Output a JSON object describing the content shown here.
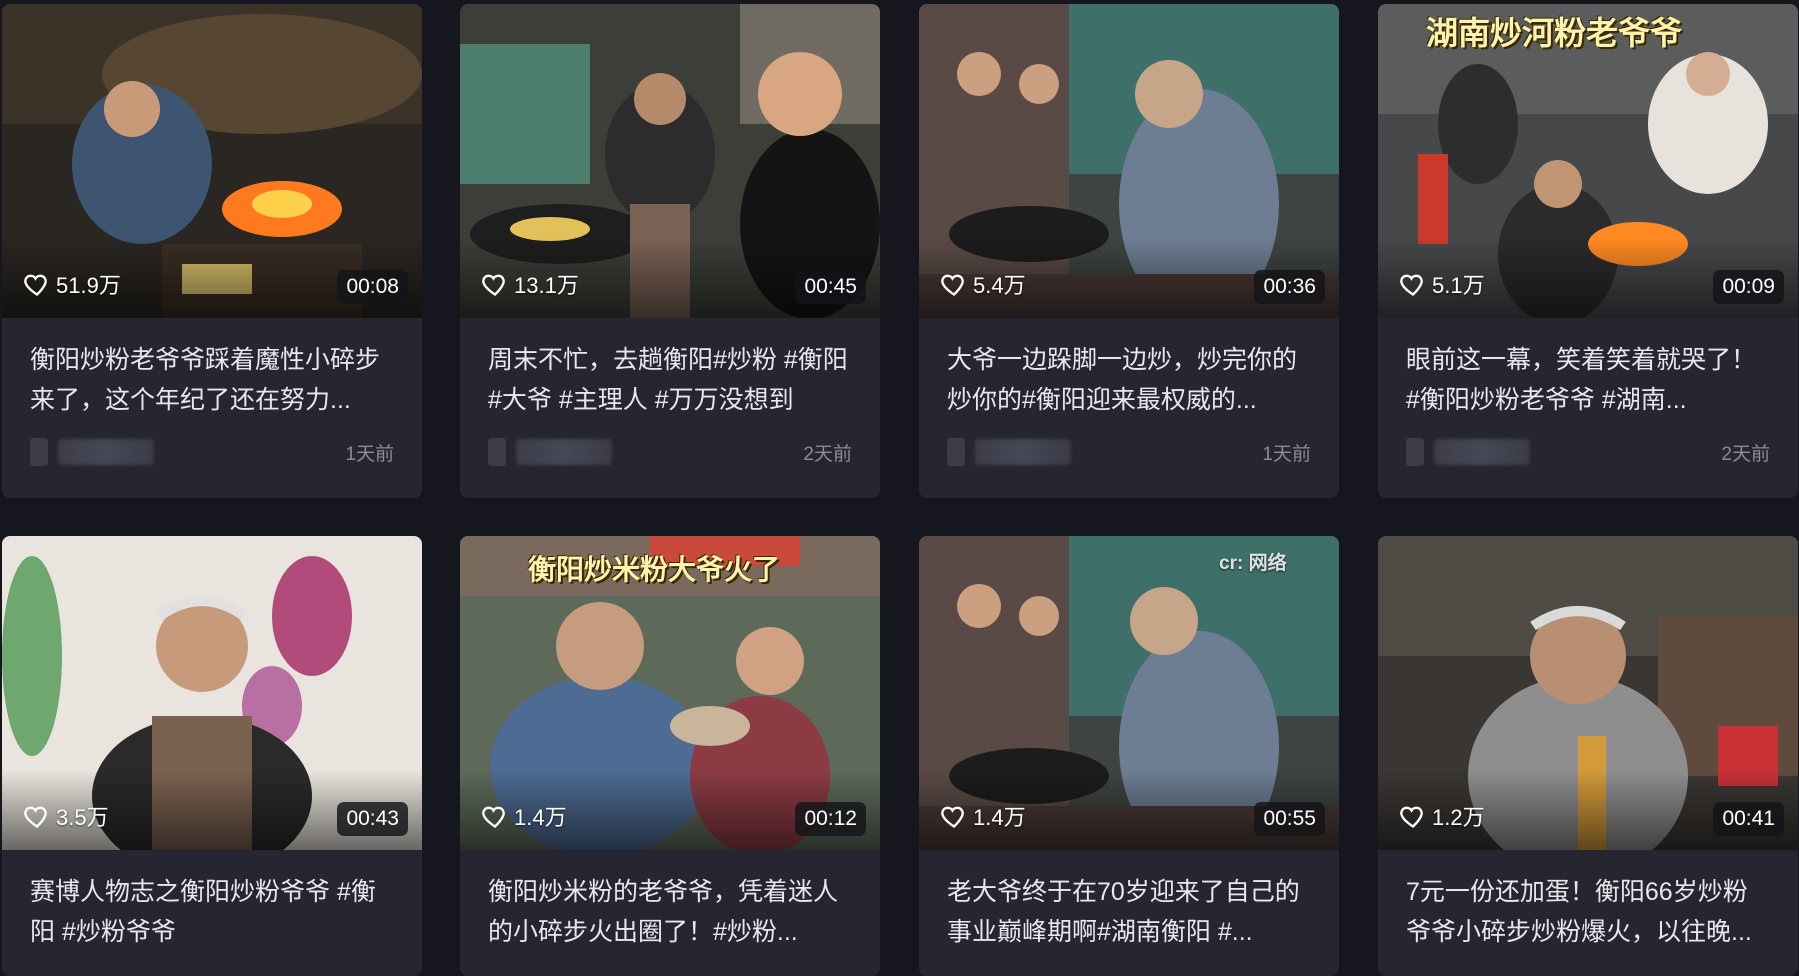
{
  "cards": [
    {
      "likes": "51.9万",
      "duration": "00:08",
      "title": "衡阳炒粉老爷爷踩着魔性小碎步来了，这个年纪了还在努力...",
      "time": "1天前",
      "overlay": ""
    },
    {
      "likes": "13.1万",
      "duration": "00:45",
      "title": "周末不忙，去趟衡阳#炒粉 #衡阳 #大爷 #主理人 #万万没想到",
      "time": "2天前",
      "overlay": ""
    },
    {
      "likes": "5.4万",
      "duration": "00:36",
      "title": "大爷一边跺脚一边炒，炒完你的炒你的#衡阳迎来最权威的...",
      "time": "1天前",
      "overlay": ""
    },
    {
      "likes": "5.1万",
      "duration": "00:09",
      "title": "眼前这一幕，笑着笑着就哭了！ #衡阳炒粉老爷爷 #湖南...",
      "time": "2天前",
      "overlay": "湖南炒河粉老爷爷"
    },
    {
      "likes": "3.5万",
      "duration": "00:43",
      "title": "赛博人物志之衡阳炒粉爷爷 #衡阳 #炒粉爷爷",
      "time": "",
      "overlay": ""
    },
    {
      "likes": "1.4万",
      "duration": "00:12",
      "title": "衡阳炒米粉的老爷爷，凭着迷人的小碎步火出圈了！#炒粉...",
      "time": "",
      "overlay": "衡阳炒米粉大爷火了"
    },
    {
      "likes": "1.4万",
      "duration": "00:55",
      "title": "老大爷终于在70岁迎来了自己的事业巅峰期啊#湖南衡阳 #...",
      "time": "",
      "overlay": "",
      "watermark": "cr: 网络"
    },
    {
      "likes": "1.2万",
      "duration": "00:41",
      "title": "7元一份还加蛋！衡阳66岁炒粉爷爷小碎步炒粉爆火，以往晚...",
      "time": "",
      "overlay": ""
    }
  ],
  "icons": {
    "like": "heart-outline-icon"
  },
  "colors": {
    "background": "#16161e",
    "card": "#252632",
    "meta_text": "#8a8b96"
  }
}
